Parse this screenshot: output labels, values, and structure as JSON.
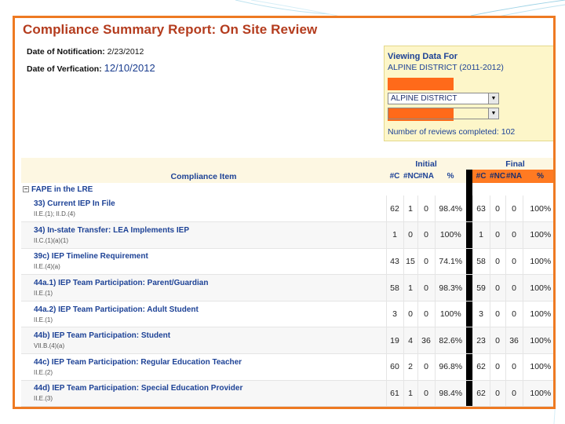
{
  "report": {
    "title": "Compliance Summary Report: On Site Review",
    "notification_label": "Date of Notification:",
    "notification_date": "2/23/2012",
    "verification_label": "Date of Verfication:",
    "verification_date": "12/10/2012"
  },
  "viewing_panel": {
    "title": "Viewing Data For",
    "district": "ALPINE DISTRICT (2011-2012)",
    "district_select_value": "ALPINE DISTRICT",
    "reviews_completed": "Number of reviews completed: 102"
  },
  "table": {
    "initial_label": "Initial",
    "final_label": "Final",
    "item_header": "Compliance Item",
    "columns": [
      "#C",
      "#NC",
      "#NA",
      "%"
    ],
    "section_label": "FAPE in the LRE",
    "toggle_symbol": "−",
    "rows": [
      {
        "title": "33) Current IEP In File",
        "ref": "II.E.(1); II.D.(4)",
        "ini": [
          "62",
          "1",
          "0",
          "98.4%"
        ],
        "fin": [
          "63",
          "0",
          "0",
          "100%"
        ]
      },
      {
        "title": "34) In-state Transfer: LEA Implements IEP",
        "ref": "II.C.(1)(a)(1)",
        "ini": [
          "1",
          "0",
          "0",
          "100%"
        ],
        "fin": [
          "1",
          "0",
          "0",
          "100%"
        ]
      },
      {
        "title": "39c) IEP Timeline Requirement",
        "ref": "II.E.(4)(a)",
        "ini": [
          "43",
          "15",
          "0",
          "74.1%"
        ],
        "fin": [
          "58",
          "0",
          "0",
          "100%"
        ]
      },
      {
        "title": "44a.1) IEP Team Participation: Parent/Guardian",
        "ref": "II.E.(1)",
        "ini": [
          "58",
          "1",
          "0",
          "98.3%"
        ],
        "fin": [
          "59",
          "0",
          "0",
          "100%"
        ]
      },
      {
        "title": "44a.2) IEP Team Participation: Adult Student",
        "ref": "II.E.(1)",
        "ini": [
          "3",
          "0",
          "0",
          "100%"
        ],
        "fin": [
          "3",
          "0",
          "0",
          "100%"
        ]
      },
      {
        "title": "44b) IEP Team Participation: Student",
        "ref": "VII.B.(4)(a)",
        "ini": [
          "19",
          "4",
          "36",
          "82.6%"
        ],
        "fin": [
          "23",
          "0",
          "36",
          "100%"
        ]
      },
      {
        "title": "44c) IEP Team Participation: Regular Education Teacher",
        "ref": "II.E.(2)",
        "ini": [
          "60",
          "2",
          "0",
          "96.8%"
        ],
        "fin": [
          "62",
          "0",
          "0",
          "100%"
        ]
      },
      {
        "title": "44d) IEP Team Participation: Special Education Provider",
        "ref": "II.E.(3)",
        "ini": [
          "61",
          "1",
          "0",
          "98.4%"
        ],
        "fin": [
          "62",
          "0",
          "0",
          "100%"
        ]
      }
    ]
  },
  "colors": {
    "frame_border": "#ee7a22",
    "title_text": "#b43c1e",
    "link_blue": "#1d4296",
    "panel_bg": "#fdf6c9",
    "orange_fill": "#ff6a1a"
  }
}
